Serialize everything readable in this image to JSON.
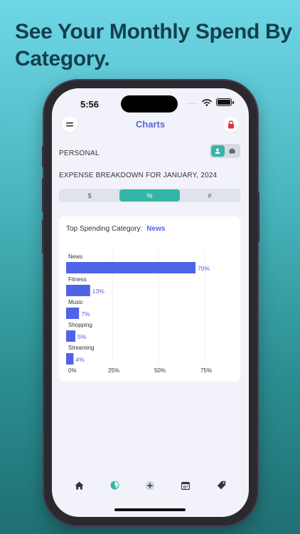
{
  "headline": "See Your Monthly Spend By Category.",
  "status": {
    "time": "5:56",
    "dots": "...."
  },
  "header": {
    "title": "Charts",
    "menu_icon": "hamburger-icon",
    "lock_icon": "lock-icon"
  },
  "account": {
    "label": "PERSONAL",
    "options": [
      "person-icon",
      "briefcase-icon"
    ],
    "selected": 0
  },
  "expense_title": "EXPENSE BREAKDOWN FOR JANUARY, 2024",
  "segments": {
    "options": [
      "$",
      "%",
      "#"
    ],
    "selected": 1
  },
  "card": {
    "top_label": "Top Spending Category:",
    "top_value": "News"
  },
  "chart_data": {
    "type": "bar",
    "orientation": "horizontal",
    "categories": [
      "News",
      "Fitness",
      "Music",
      "Shopping",
      "Streaming"
    ],
    "values": [
      70,
      13,
      7,
      5,
      4
    ],
    "value_labels": [
      "70%",
      "13%",
      "7%",
      "5%",
      "4%"
    ],
    "xticks": [
      "0%",
      "25%",
      "50%",
      "75%"
    ],
    "xlim": [
      0,
      80
    ],
    "grid": true,
    "bar_color": "#4f63e8"
  },
  "tabbar": {
    "items": [
      "home-icon",
      "pie-chart-icon",
      "plus-icon",
      "calendar-icon",
      "tag-icon"
    ],
    "selected": 1
  },
  "colors": {
    "accent": "#35b5a6",
    "title": "#5a66d8",
    "bar": "#4f63e8",
    "lock": "#e0343c"
  }
}
